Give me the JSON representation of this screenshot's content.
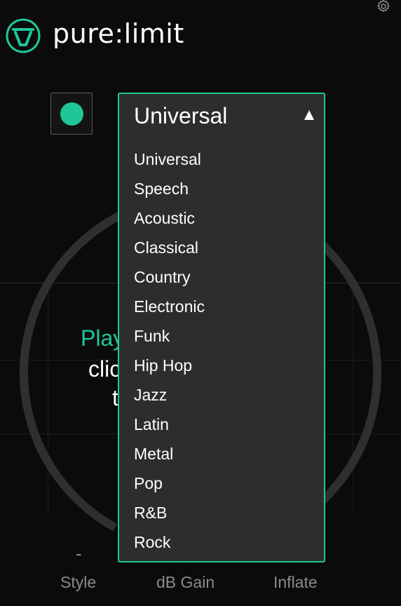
{
  "app": {
    "name": "pure:limit"
  },
  "colors": {
    "accent": "#1fc798",
    "background": "#0b0b0b",
    "dropdown_bg": "#2d2d2d",
    "muted_text": "#8a8a8a"
  },
  "icons": {
    "logo": "pure-logo-icon",
    "settings": "gear-icon",
    "caret": "caret-up-icon"
  },
  "power": {
    "state": "on"
  },
  "meter": {
    "message_line1": "Play",
    "message_line2": "clic",
    "message_line3": "t"
  },
  "style_dropdown": {
    "selected": "Universal",
    "options": [
      "Universal",
      "Speech",
      "Acoustic",
      "Classical",
      "Country",
      "Electronic",
      "Funk",
      "Hip Hop",
      "Jazz",
      "Latin",
      "Metal",
      "Pop",
      "R&B",
      "Rock"
    ]
  },
  "controls": {
    "style_value": "-",
    "style_label": "Style",
    "gain_label": "dB Gain",
    "inflate_label": "Inflate"
  }
}
